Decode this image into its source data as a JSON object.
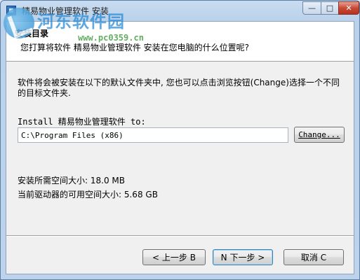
{
  "window": {
    "title": "精易物业管理软件 安装",
    "controls": {
      "minimize": "—",
      "maximize": "□",
      "close": "✕"
    }
  },
  "watermark": {
    "text": "河东软件园",
    "url": "www.pc0359.cn"
  },
  "header": {
    "title": "安装目录",
    "subtitle": "您打算将软件 精易物业管理软件 安装在您电脑的什么位置呢?"
  },
  "body": {
    "description": "软件将会被安装在以下的默认文件夹中, 您也可以点击浏览按钮(Change)选择一个不同的目标文件夹.",
    "install_label": "Install 精易物业管理软件 to:",
    "install_path": "C:\\Program Files (x86)",
    "change_button": "Change...",
    "space_required": "安装所需空间大小: 18.0 MB",
    "space_available": "当前驱动器的可用空间大小: 5.68 GB"
  },
  "footer": {
    "back_button": "< 上一步 B",
    "next_button": "N 下一步 >",
    "cancel_button": "取消 C"
  },
  "colors": {
    "title_bar": "#b9d1ea",
    "accent": "#3c7fb1",
    "close": "#c74a35"
  }
}
